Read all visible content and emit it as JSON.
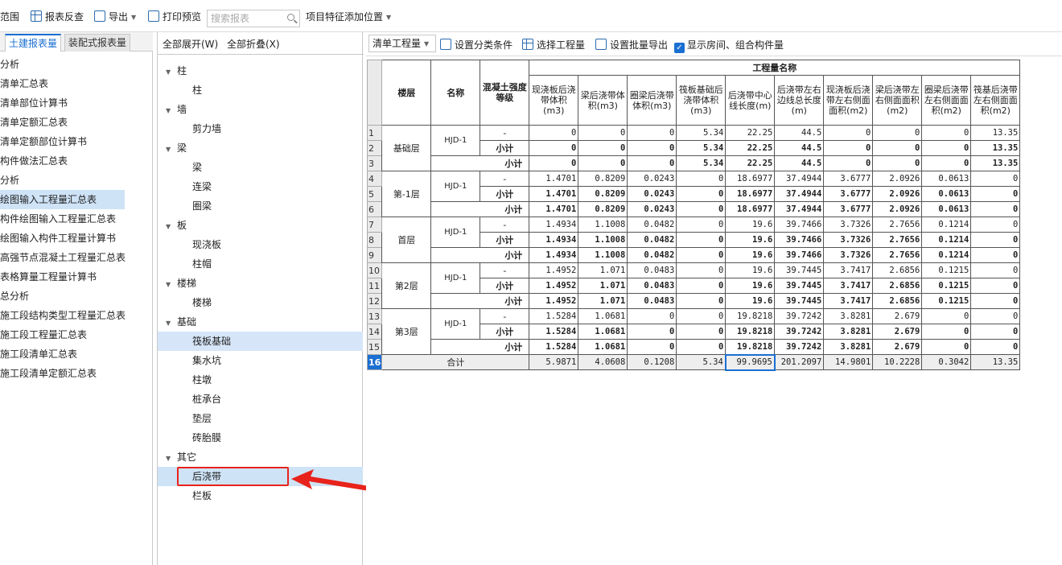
{
  "toolbar": {
    "items": [
      "范围",
      "报表反查",
      "导出",
      "打印预览",
      "项目特征添加位置"
    ],
    "search_placeholder": "搜索报表"
  },
  "left_panel": {
    "tabs": [
      "土建报表量",
      "装配式报表量"
    ],
    "items": [
      "分析",
      "清单汇总表",
      "清单部位计算书",
      "清单定额汇总表",
      "清单定额部位计算书",
      "构件做法汇总表",
      "分析",
      "绘图输入工程量汇总表",
      "构件绘图输入工程量汇总表",
      "绘图输入构件工程量计算书",
      "高强节点混凝土工程量汇总表",
      "表格算量工程量计算书",
      "总分析",
      "施工段结构类型工程量汇总表",
      "施工段工程量汇总表",
      "施工段清单汇总表",
      "施工段清单定额汇总表"
    ]
  },
  "mid_panel": {
    "expand_all": "全部展开(W)",
    "collapse_all": "全部折叠(X)",
    "tree": [
      {
        "group": "柱",
        "children": [
          "柱"
        ]
      },
      {
        "group": "墙",
        "children": [
          "剪力墙"
        ]
      },
      {
        "group": "梁",
        "children": [
          "梁",
          "连梁",
          "圈梁"
        ]
      },
      {
        "group": "板",
        "children": [
          "现浇板",
          "柱帽"
        ]
      },
      {
        "group": "楼梯",
        "children": [
          "楼梯"
        ]
      },
      {
        "group": "基础",
        "children": [
          "筏板基础",
          "集水坑",
          "柱墩",
          "桩承台",
          "垫层",
          "砖胎膜"
        ]
      },
      {
        "group": "其它",
        "children": [
          "后浇带",
          "栏板"
        ]
      }
    ]
  },
  "right_panel": {
    "mode": "清单工程量",
    "set_category": "设置分类条件",
    "select_quantity": "选择工程量",
    "batch_export": "设置批量导出",
    "show_rooms": "显示房间、组合构件量"
  },
  "sheet": {
    "header_main": "工程量名称",
    "col_floor": "楼层",
    "col_name": "名称",
    "col_grade": "混凝土强度等级",
    "columns": [
      "现浇板后浇带体积(m3)",
      "梁后浇带体积(m3)",
      "圈梁后浇带体积(m3)",
      "筏板基础后浇带体积(m3)",
      "后浇带中心线长度(m)",
      "后浇带左右边线总长度(m)",
      "现浇板后浇带左右侧面面积(m2)",
      "梁后浇带左右侧面面积(m2)",
      "圈梁后浇带左右侧面面积(m2)",
      "筏基后浇带左右侧面面积(m2)"
    ],
    "dash": "-",
    "subtotal": "小计",
    "total_label": "合计",
    "floors": [
      {
        "floor": "基础层",
        "name": "HJD-1",
        "detail": [
          "0",
          "0",
          "0",
          "5.34",
          "22.25",
          "44.5",
          "0",
          "0",
          "0",
          "13.35"
        ],
        "sub1": [
          "0",
          "0",
          "0",
          "5.34",
          "22.25",
          "44.5",
          "0",
          "0",
          "0",
          "13.35"
        ],
        "sub2": [
          "0",
          "0",
          "0",
          "5.34",
          "22.25",
          "44.5",
          "0",
          "0",
          "0",
          "13.35"
        ]
      },
      {
        "floor": "第-1层",
        "name": "HJD-1",
        "detail": [
          "1.4701",
          "0.8209",
          "0.0243",
          "0",
          "18.6977",
          "37.4944",
          "3.6777",
          "2.0926",
          "0.0613",
          "0"
        ],
        "sub1": [
          "1.4701",
          "0.8209",
          "0.0243",
          "0",
          "18.6977",
          "37.4944",
          "3.6777",
          "2.0926",
          "0.0613",
          "0"
        ],
        "sub2": [
          "1.4701",
          "0.8209",
          "0.0243",
          "0",
          "18.6977",
          "37.4944",
          "3.6777",
          "2.0926",
          "0.0613",
          "0"
        ]
      },
      {
        "floor": "首层",
        "name": "HJD-1",
        "detail": [
          "1.4934",
          "1.1008",
          "0.0482",
          "0",
          "19.6",
          "39.7466",
          "3.7326",
          "2.7656",
          "0.1214",
          "0"
        ],
        "sub1": [
          "1.4934",
          "1.1008",
          "0.0482",
          "0",
          "19.6",
          "39.7466",
          "3.7326",
          "2.7656",
          "0.1214",
          "0"
        ],
        "sub2": [
          "1.4934",
          "1.1008",
          "0.0482",
          "0",
          "19.6",
          "39.7466",
          "3.7326",
          "2.7656",
          "0.1214",
          "0"
        ]
      },
      {
        "floor": "第2层",
        "name": "HJD-1",
        "detail": [
          "1.4952",
          "1.071",
          "0.0483",
          "0",
          "19.6",
          "39.7445",
          "3.7417",
          "2.6856",
          "0.1215",
          "0"
        ],
        "sub1": [
          "1.4952",
          "1.071",
          "0.0483",
          "0",
          "19.6",
          "39.7445",
          "3.7417",
          "2.6856",
          "0.1215",
          "0"
        ],
        "sub2": [
          "1.4952",
          "1.071",
          "0.0483",
          "0",
          "19.6",
          "39.7445",
          "3.7417",
          "2.6856",
          "0.1215",
          "0"
        ]
      },
      {
        "floor": "第3层",
        "name": "HJD-1",
        "detail": [
          "1.5284",
          "1.0681",
          "0",
          "0",
          "19.8218",
          "39.7242",
          "3.8281",
          "2.679",
          "0",
          "0"
        ],
        "sub1": [
          "1.5284",
          "1.0681",
          "0",
          "0",
          "19.8218",
          "39.7242",
          "3.8281",
          "2.679",
          "0",
          "0"
        ],
        "sub2": [
          "1.5284",
          "1.0681",
          "0",
          "0",
          "19.8218",
          "39.7242",
          "3.8281",
          "2.679",
          "0",
          "0"
        ]
      }
    ],
    "total": [
      "5.9871",
      "4.0608",
      "0.1208",
      "5.34",
      "99.9695",
      "201.2097",
      "14.9801",
      "10.2228",
      "0.3042",
      "13.35"
    ],
    "active_row": "16"
  },
  "colors": {
    "accent": "#1a6fd1",
    "annotation": "#e8231b",
    "selection": "#cfe3f7"
  }
}
